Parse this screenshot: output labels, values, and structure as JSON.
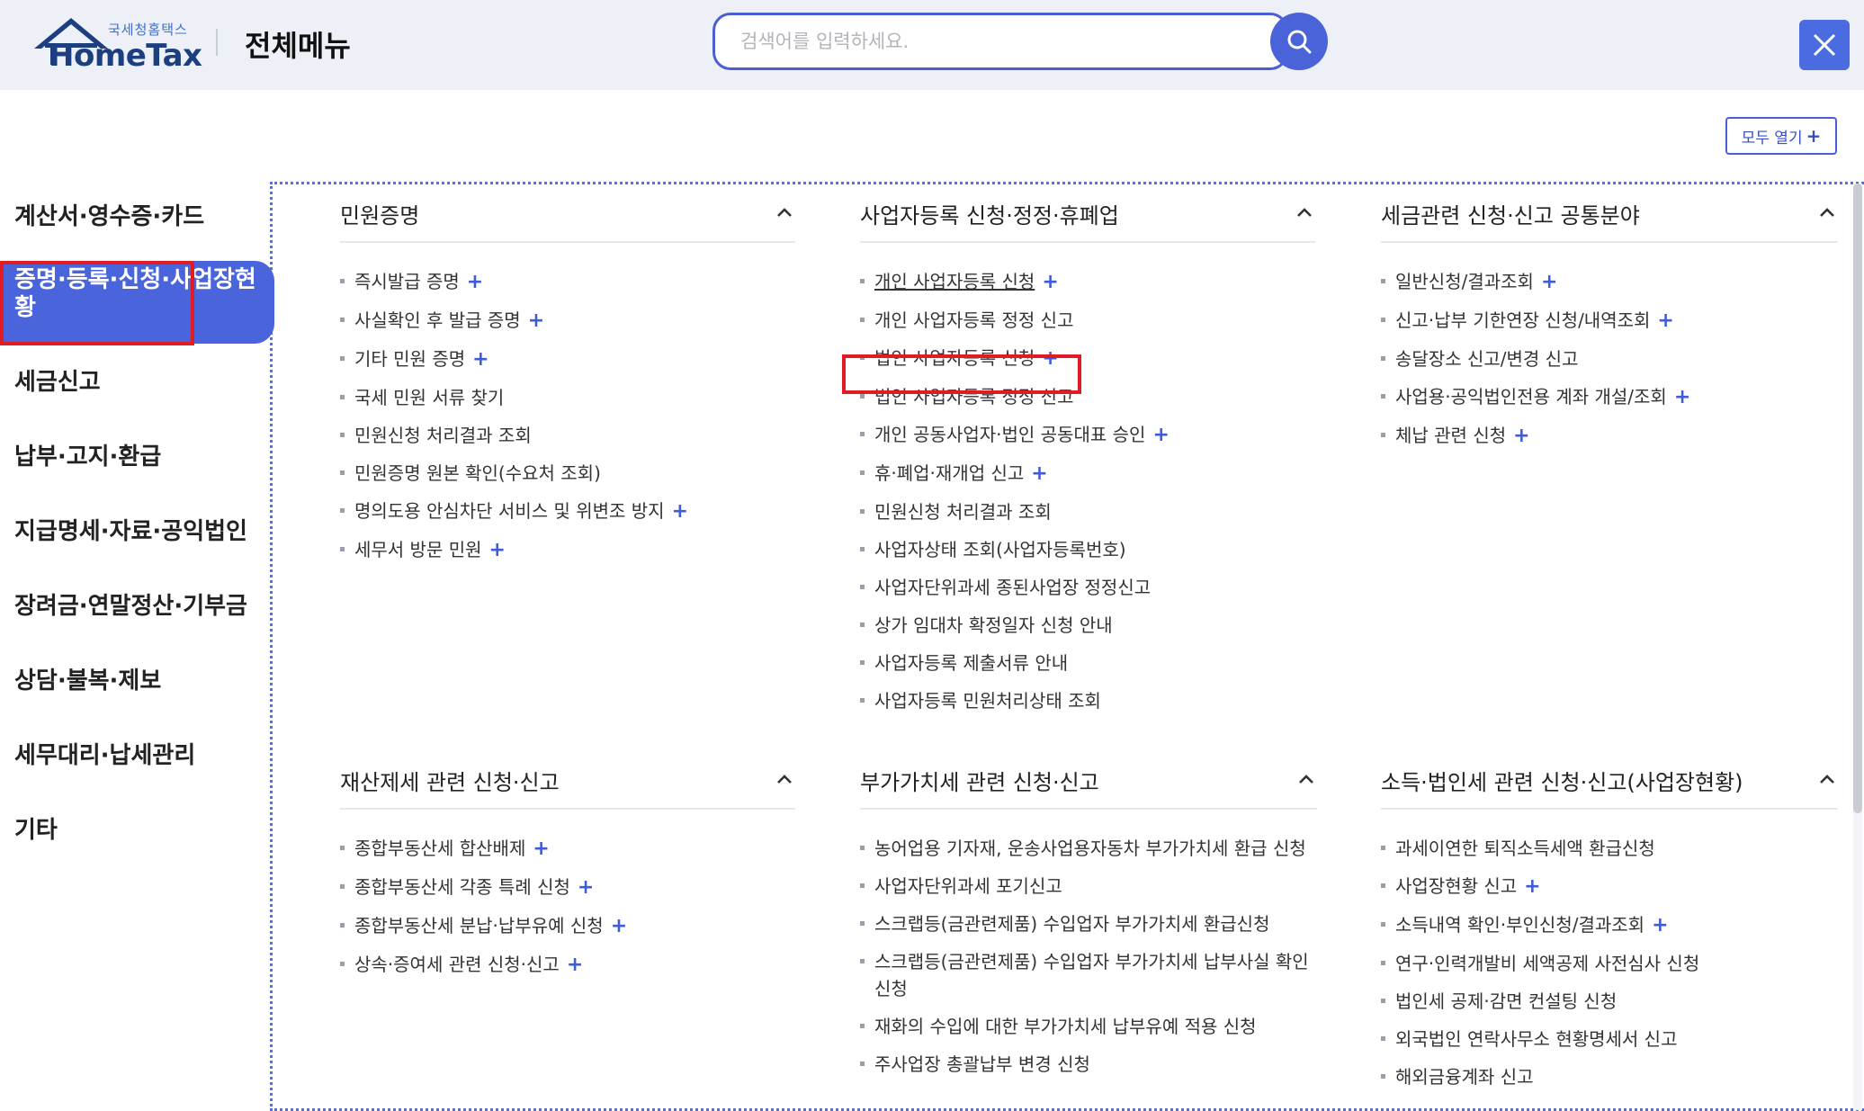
{
  "header": {
    "logo_small": "국세청홈택스",
    "logo_main": "HomeTax",
    "title": "전체메뉴",
    "search_placeholder": "검색어를 입력하세요."
  },
  "expand_all": {
    "label": "모두 열기",
    "plus": "+"
  },
  "sidebar": {
    "items": [
      {
        "label": "계산서·영수증·카드"
      },
      {
        "label": "증명·등록·신청·사업장현황",
        "active": true
      },
      {
        "label": "세금신고"
      },
      {
        "label": "납부·고지·환급"
      },
      {
        "label": "지급명세·자료·공익법인"
      },
      {
        "label": "장려금·연말정산·기부금"
      },
      {
        "label": "상담·불복·제보"
      },
      {
        "label": "세무대리·납세관리"
      },
      {
        "label": "기타"
      }
    ]
  },
  "sections": [
    {
      "title": "민원증명",
      "items": [
        {
          "label": "즉시발급 증명",
          "plus": "+"
        },
        {
          "label": "사실확인 후 발급 증명",
          "plus": "+"
        },
        {
          "label": "기타 민원 증명",
          "plus": "+"
        },
        {
          "label": "국세 민원 서류 찾기"
        },
        {
          "label": "민원신청 처리결과 조회"
        },
        {
          "label": "민원증명 원본 확인(수요처 조회)"
        },
        {
          "label": "명의도용 안심차단 서비스 및 위변조 방지",
          "plus": "+"
        },
        {
          "label": "세무서 방문 민원",
          "plus": "+"
        }
      ]
    },
    {
      "title": "사업자등록 신청·정정·휴폐업",
      "items": [
        {
          "label": "개인 사업자등록 신청",
          "plus": "+"
        },
        {
          "label": "개인 사업자등록 정정 신고"
        },
        {
          "label": "법인 사업자등록 신청",
          "plus": "+"
        },
        {
          "label": "법인 사업자등록 정정 신고"
        },
        {
          "label": "개인 공동사업자·법인 공동대표 승인",
          "plus": "+"
        },
        {
          "label": "휴·폐업·재개업 신고",
          "plus": "+"
        },
        {
          "label": "민원신청 처리결과 조회"
        },
        {
          "label": "사업자상태 조회(사업자등록번호)"
        },
        {
          "label": "사업자단위과세 종된사업장 정정신고"
        },
        {
          "label": "상가 임대차 확정일자 신청 안내"
        },
        {
          "label": "사업자등록 제출서류 안내"
        },
        {
          "label": "사업자등록 민원처리상태 조회"
        }
      ]
    },
    {
      "title": "세금관련 신청·신고 공통분야",
      "items": [
        {
          "label": "일반신청/결과조회",
          "plus": "+"
        },
        {
          "label": "신고·납부 기한연장 신청/내역조회",
          "plus": "+"
        },
        {
          "label": "송달장소 신고/변경 신고"
        },
        {
          "label": "사업용·공익법인전용 계좌 개설/조회",
          "plus": "+"
        },
        {
          "label": "체납 관련 신청",
          "plus": "+"
        }
      ]
    },
    {
      "title": "재산제세 관련 신청·신고",
      "items": [
        {
          "label": "종합부동산세 합산배제",
          "plus": "+"
        },
        {
          "label": "종합부동산세 각종 특례 신청",
          "plus": "+"
        },
        {
          "label": "종합부동산세 분납·납부유예 신청",
          "plus": "+"
        },
        {
          "label": "상속·증여세 관련 신청·신고",
          "plus": "+"
        }
      ]
    },
    {
      "title": "부가가치세 관련 신청·신고",
      "items": [
        {
          "label": "농어업용 기자재, 운송사업용자동차 부가가치세 환급 신청"
        },
        {
          "label": "사업자단위과세 포기신고"
        },
        {
          "label": "스크랩등(금관련제품) 수입업자 부가가치세 환급신청"
        },
        {
          "label": "스크랩등(금관련제품) 수입업자 부가가치세 납부사실 확인신청",
          "wrap": true
        },
        {
          "label": "재화의 수입에 대한 부가가치세 납부유예 적용 신청"
        },
        {
          "label": "주사업장 총괄납부 변경 신청"
        }
      ]
    },
    {
      "title": "소득·법인세 관련 신청·신고(사업장현황)",
      "items": [
        {
          "label": "과세이연한 퇴직소득세액 환급신청"
        },
        {
          "label": "사업장현황 신고",
          "plus": "+"
        },
        {
          "label": "소득내역 확인·부인신청/결과조회",
          "plus": "+"
        },
        {
          "label": "연구·인력개발비 세액공제 사전심사 신청"
        },
        {
          "label": "법인세 공제·감면 컨설팅 신청"
        },
        {
          "label": "외국법인 연락사무소 현황명세서 신고"
        },
        {
          "label": "해외금융계좌 신고"
        }
      ]
    }
  ],
  "colors": {
    "accent": "#4a64dc",
    "plus": "#3f5bd9",
    "highlight": "#e01b24",
    "header_bg": "#edf0f6"
  }
}
